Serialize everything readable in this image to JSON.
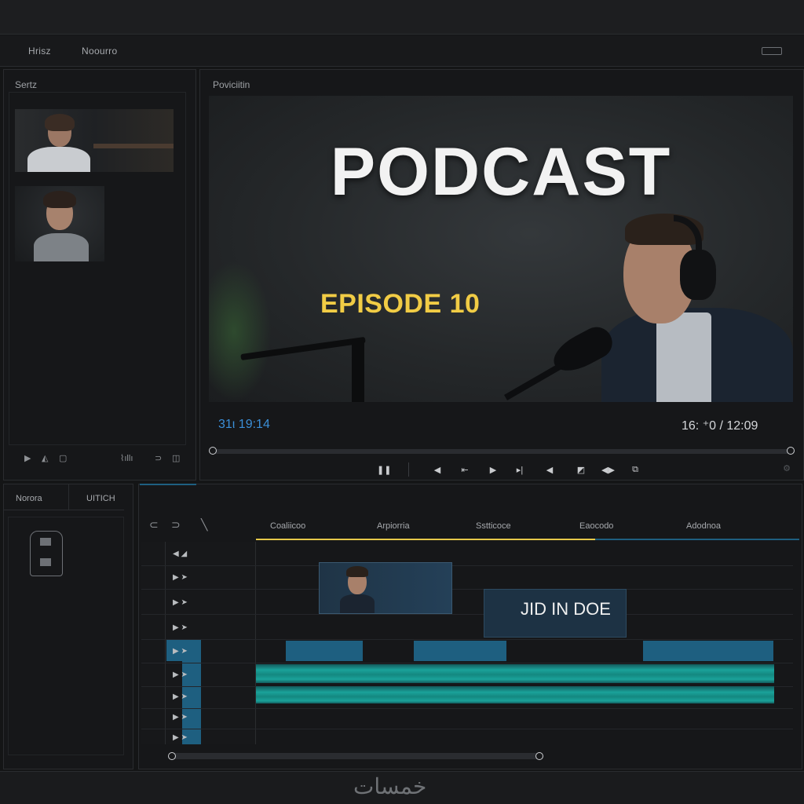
{
  "menu": {
    "item1": "Hrisz",
    "item2": "Noourro"
  },
  "media_panel": {
    "title": "Sertz",
    "controls": {
      "play": "▶",
      "step": "◭",
      "stop": "▢",
      "waveform": "⌇ıllı",
      "loop": "⊃",
      "snap": "◫"
    }
  },
  "preview_panel": {
    "title": "Poviciitin",
    "overlay_title": "PODCAST",
    "overlay_subtitle": "EPISODE 10",
    "timecode_current": "31ι 19:14",
    "timecode_end": "16: ⁺0 / 12:09",
    "transport": {
      "pause": "❚❚",
      "prev": "◀",
      "mark_in": "⇤",
      "play": "▶",
      "next_frame": "▸|",
      "prev_frame": "◀",
      "fullscreen": "◩",
      "skip": "◀▶",
      "caption": "⧉",
      "settings": "⚙"
    }
  },
  "bottom_left": {
    "tab1": "Norora",
    "tab2": "UITICH"
  },
  "timeline": {
    "headers": [
      "Coaliicoo",
      "Arpiorria",
      "Sstticoce",
      "Eaocodo",
      "Adodnoa"
    ],
    "tools": {
      "magnet": "⊂",
      "link": "⊃",
      "razor": "╲"
    },
    "title_clip_text": "JID IN DOE",
    "track_icons": [
      "◀ ◢",
      "▶ ➤",
      "▶ ➤",
      "▶ ➤",
      "▶ ➤",
      "▶ ➤",
      "▶ ➤",
      "▶ ➤",
      "▶ ➤"
    ]
  },
  "watermark": "خمسات",
  "colors": {
    "accent_blue": "#1e5f80",
    "audio_teal": "#1aa29a",
    "title_yellow": "#f1cc45",
    "timecode_blue": "#3b8fd8"
  }
}
